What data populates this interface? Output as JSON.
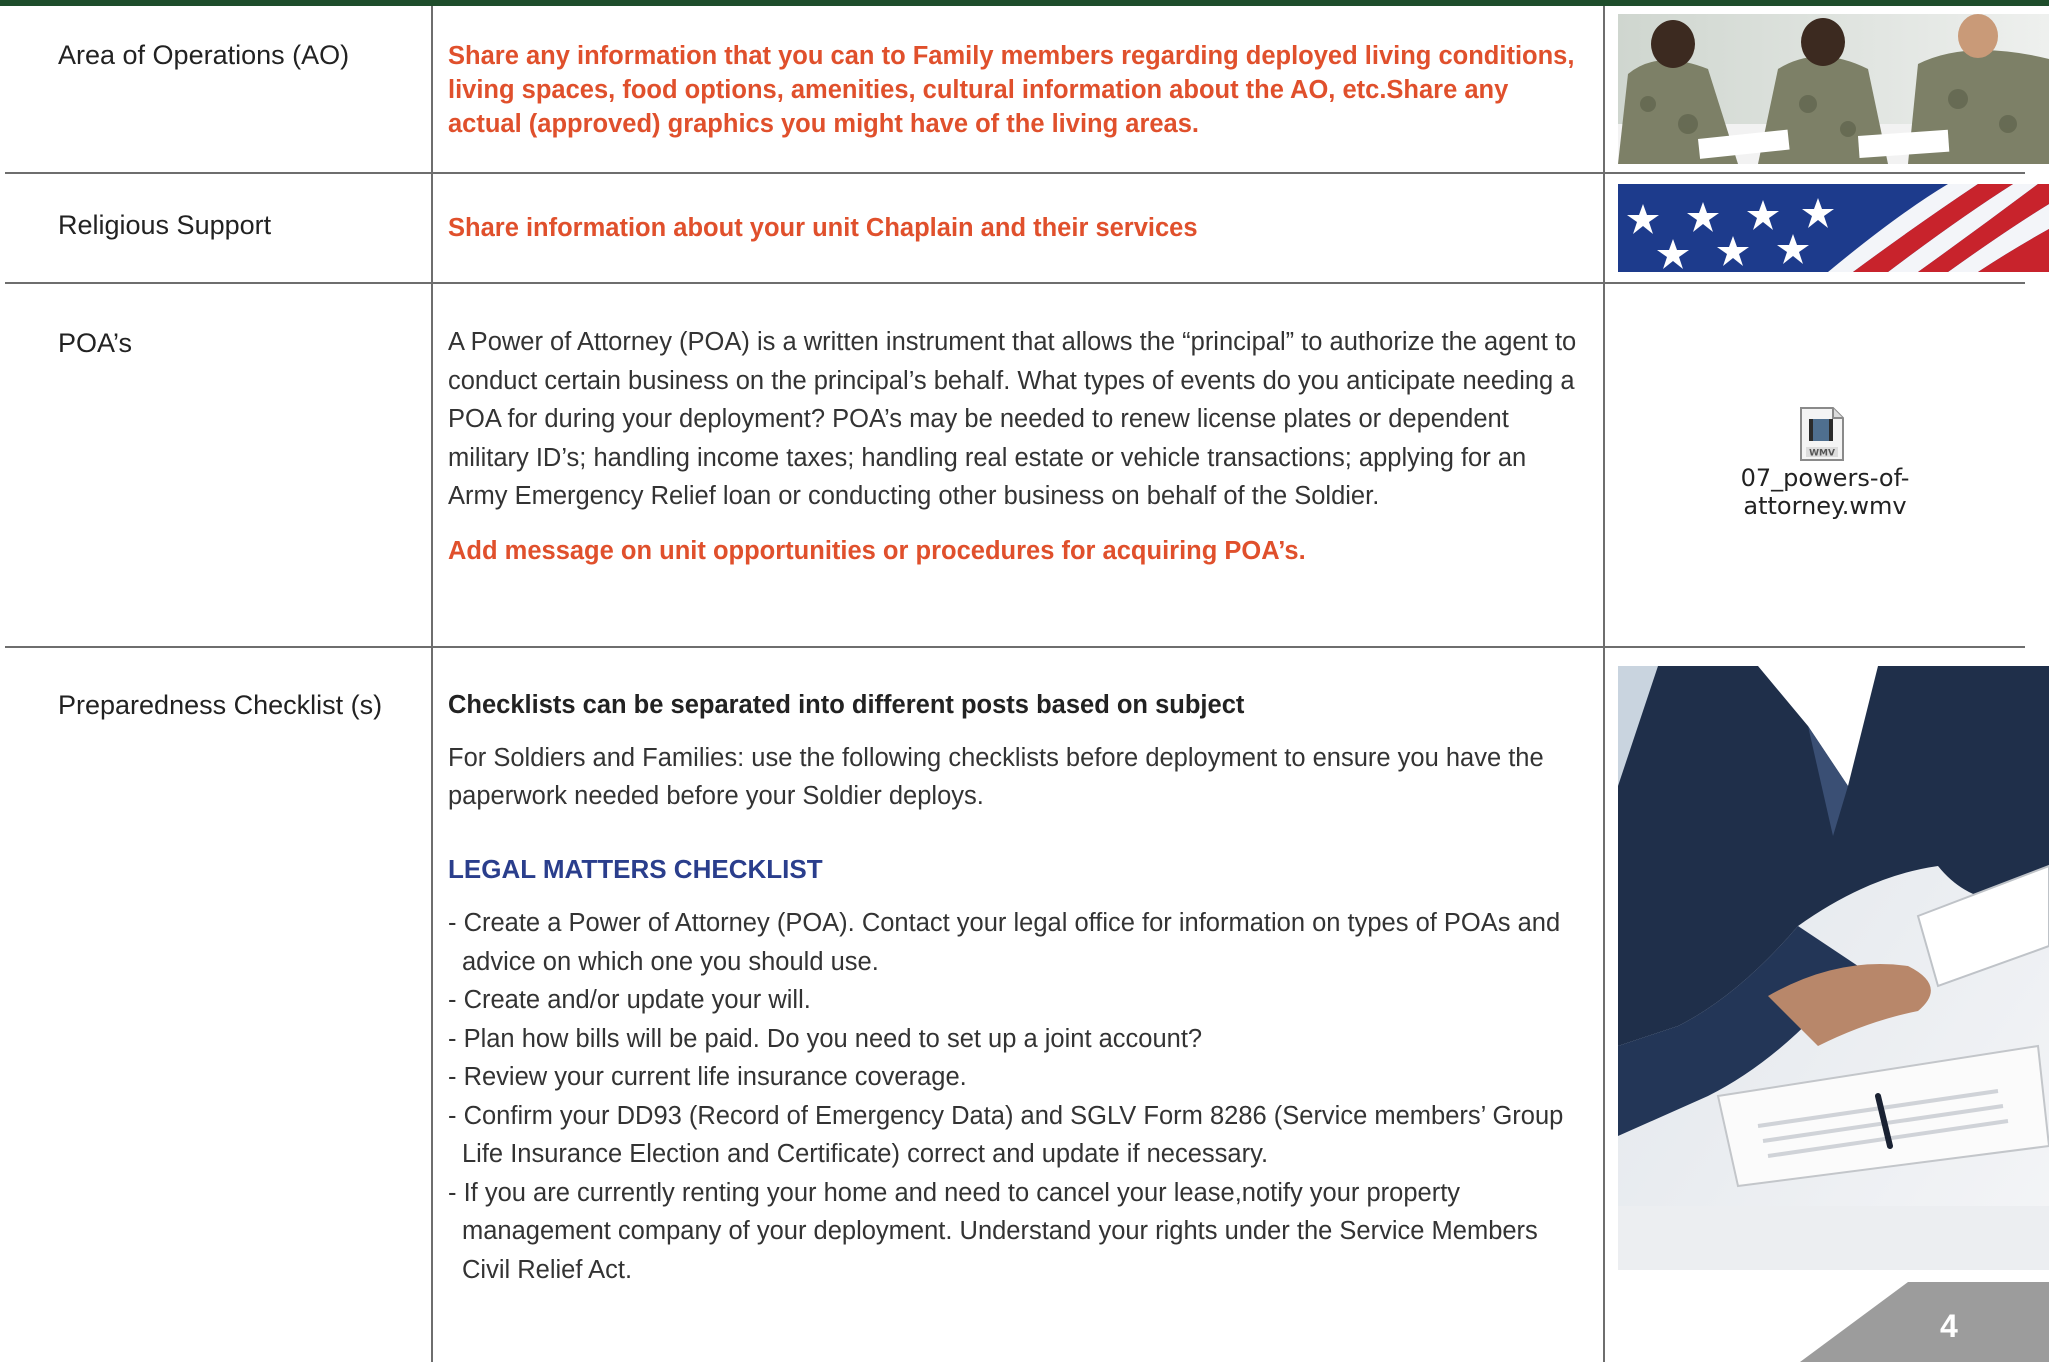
{
  "rows": [
    {
      "label": "Area of Operations (AO)",
      "text": "Share any information that you can to Family members regarding deployed living conditions, living spaces, food options, amenities, cultural information about the AO, etc.Share any actual (approved) graphics you might have of the living areas."
    },
    {
      "label": "Religious Support",
      "text": "Share information about your unit Chaplain and their services"
    },
    {
      "label": "POA’s",
      "text": "A Power of Attorney (POA)  is a written instrument that allows the “principal” to authorize the agent to conduct certain business on the principal’s behalf. What types of events do you anticipate needing a POA for during your deployment? POA’s may be needed to renew license plates or dependent military ID’s; handling income taxes; handling real estate or vehicle transactions; applying for an Army Emergency Relief loan or conducting other business on behalf of the Soldier.",
      "note": "Add message on unit opportunities or procedures for acquiring POA’s.",
      "file_icon_label": "WMV",
      "file_name": "07_powers-of-attorney.wmv"
    },
    {
      "label": "Preparedness Checklist (s)",
      "heading": "Checklists can be separated into different posts based on subject",
      "intro": "For Soldiers and Families: use the following checklists before deployment to ensure you have the paperwork needed before your Soldier deploys.",
      "checklist_title": "LEGAL MATTERS CHECKLIST",
      "items": [
        "- Create a Power of Attorney (POA). Contact your legal office for information on types of POAs and advice on which one you should use.",
        "- Create and/or update your will.",
        "- Plan how bills will be paid. Do you need to set up a joint account?",
        "- Review your current life insurance coverage.",
        "- Confirm your DD93 (Record of Emergency Data) and SGLV Form 8286 (Service members’ Group Life Insurance Election and Certificate) correct and update if necessary.",
        "- If you are currently renting your home and need to cancel your lease,notify your property management company of your deployment. Understand your rights under the Service Members Civil Relief Act."
      ]
    }
  ],
  "page_number": "4",
  "colors": {
    "accent_orange": "#e0502c",
    "heading_blue": "#2a3e8c",
    "top_bar_green": "#1e4d2b",
    "page_tab_gray": "#9c9c9c"
  }
}
